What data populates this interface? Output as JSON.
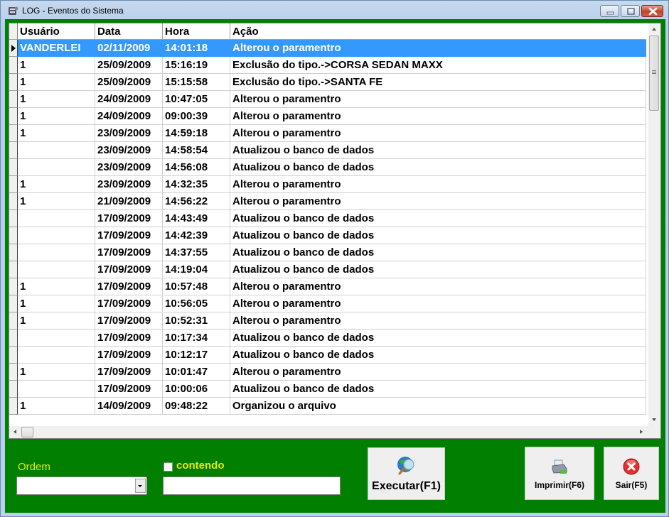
{
  "window": {
    "title": "LOG - Eventos do Sistema",
    "icons": {
      "app": "app-log-icon",
      "minimize": "minimize-icon",
      "maximize": "maximize-icon",
      "close": "close-icon"
    }
  },
  "grid": {
    "columns": [
      "Usuário",
      "Data",
      "Hora",
      "Ação"
    ],
    "selected_row": 0,
    "rows": [
      {
        "usuario": "VANDERLEI",
        "data": "02/11/2009",
        "hora": "14:01:18",
        "acao": "Alterou o paramentro"
      },
      {
        "usuario": "1",
        "data": "25/09/2009",
        "hora": "15:16:19",
        "acao": "Exclusão do tipo.->CORSA SEDAN MAXX"
      },
      {
        "usuario": "1",
        "data": "25/09/2009",
        "hora": "15:15:58",
        "acao": "Exclusão do tipo.->SANTA FE"
      },
      {
        "usuario": "1",
        "data": "24/09/2009",
        "hora": "10:47:05",
        "acao": "Alterou o paramentro"
      },
      {
        "usuario": "1",
        "data": "24/09/2009",
        "hora": "09:00:39",
        "acao": "Alterou o paramentro"
      },
      {
        "usuario": "1",
        "data": "23/09/2009",
        "hora": "14:59:18",
        "acao": "Alterou o paramentro"
      },
      {
        "usuario": "",
        "data": "23/09/2009",
        "hora": "14:58:54",
        "acao": "Atualizou o banco de dados"
      },
      {
        "usuario": "",
        "data": "23/09/2009",
        "hora": "14:56:08",
        "acao": "Atualizou o banco de dados"
      },
      {
        "usuario": "1",
        "data": "23/09/2009",
        "hora": "14:32:35",
        "acao": "Alterou o paramentro"
      },
      {
        "usuario": "1",
        "data": "21/09/2009",
        "hora": "14:56:22",
        "acao": "Alterou o paramentro"
      },
      {
        "usuario": "",
        "data": "17/09/2009",
        "hora": "14:43:49",
        "acao": "Atualizou o banco de dados"
      },
      {
        "usuario": "",
        "data": "17/09/2009",
        "hora": "14:42:39",
        "acao": "Atualizou o banco de dados"
      },
      {
        "usuario": "",
        "data": "17/09/2009",
        "hora": "14:37:55",
        "acao": "Atualizou o banco de dados"
      },
      {
        "usuario": "",
        "data": "17/09/2009",
        "hora": "14:19:04",
        "acao": "Atualizou o banco de dados"
      },
      {
        "usuario": "1",
        "data": "17/09/2009",
        "hora": "10:57:48",
        "acao": "Alterou o paramentro"
      },
      {
        "usuario": "1",
        "data": "17/09/2009",
        "hora": "10:56:05",
        "acao": "Alterou o paramentro"
      },
      {
        "usuario": "1",
        "data": "17/09/2009",
        "hora": "10:52:31",
        "acao": "Alterou o paramentro"
      },
      {
        "usuario": "",
        "data": "17/09/2009",
        "hora": "10:17:34",
        "acao": "Atualizou o banco de dados"
      },
      {
        "usuario": "",
        "data": "17/09/2009",
        "hora": "10:12:17",
        "acao": "Atualizou o banco de dados"
      },
      {
        "usuario": "1",
        "data": "17/09/2009",
        "hora": "10:01:47",
        "acao": "Alterou o paramentro"
      },
      {
        "usuario": "",
        "data": "17/09/2009",
        "hora": "10:00:06",
        "acao": "Atualizou o banco de dados"
      },
      {
        "usuario": "1",
        "data": "14/09/2009",
        "hora": "09:48:22",
        "acao": "Organizou o arquivo"
      }
    ]
  },
  "filters": {
    "ordem_label": "Ordem",
    "ordem_value": "",
    "contendo_label": "contendo",
    "contendo_checked": false,
    "contendo_value": ""
  },
  "buttons": {
    "executar": "Executar(F1)",
    "imprimir": "Imprimir(F6)",
    "sair": "Sair(F5)"
  },
  "colors": {
    "panel_bg": "#007f00",
    "label_yellow": "#e8e800",
    "selection": "#3399ff"
  }
}
